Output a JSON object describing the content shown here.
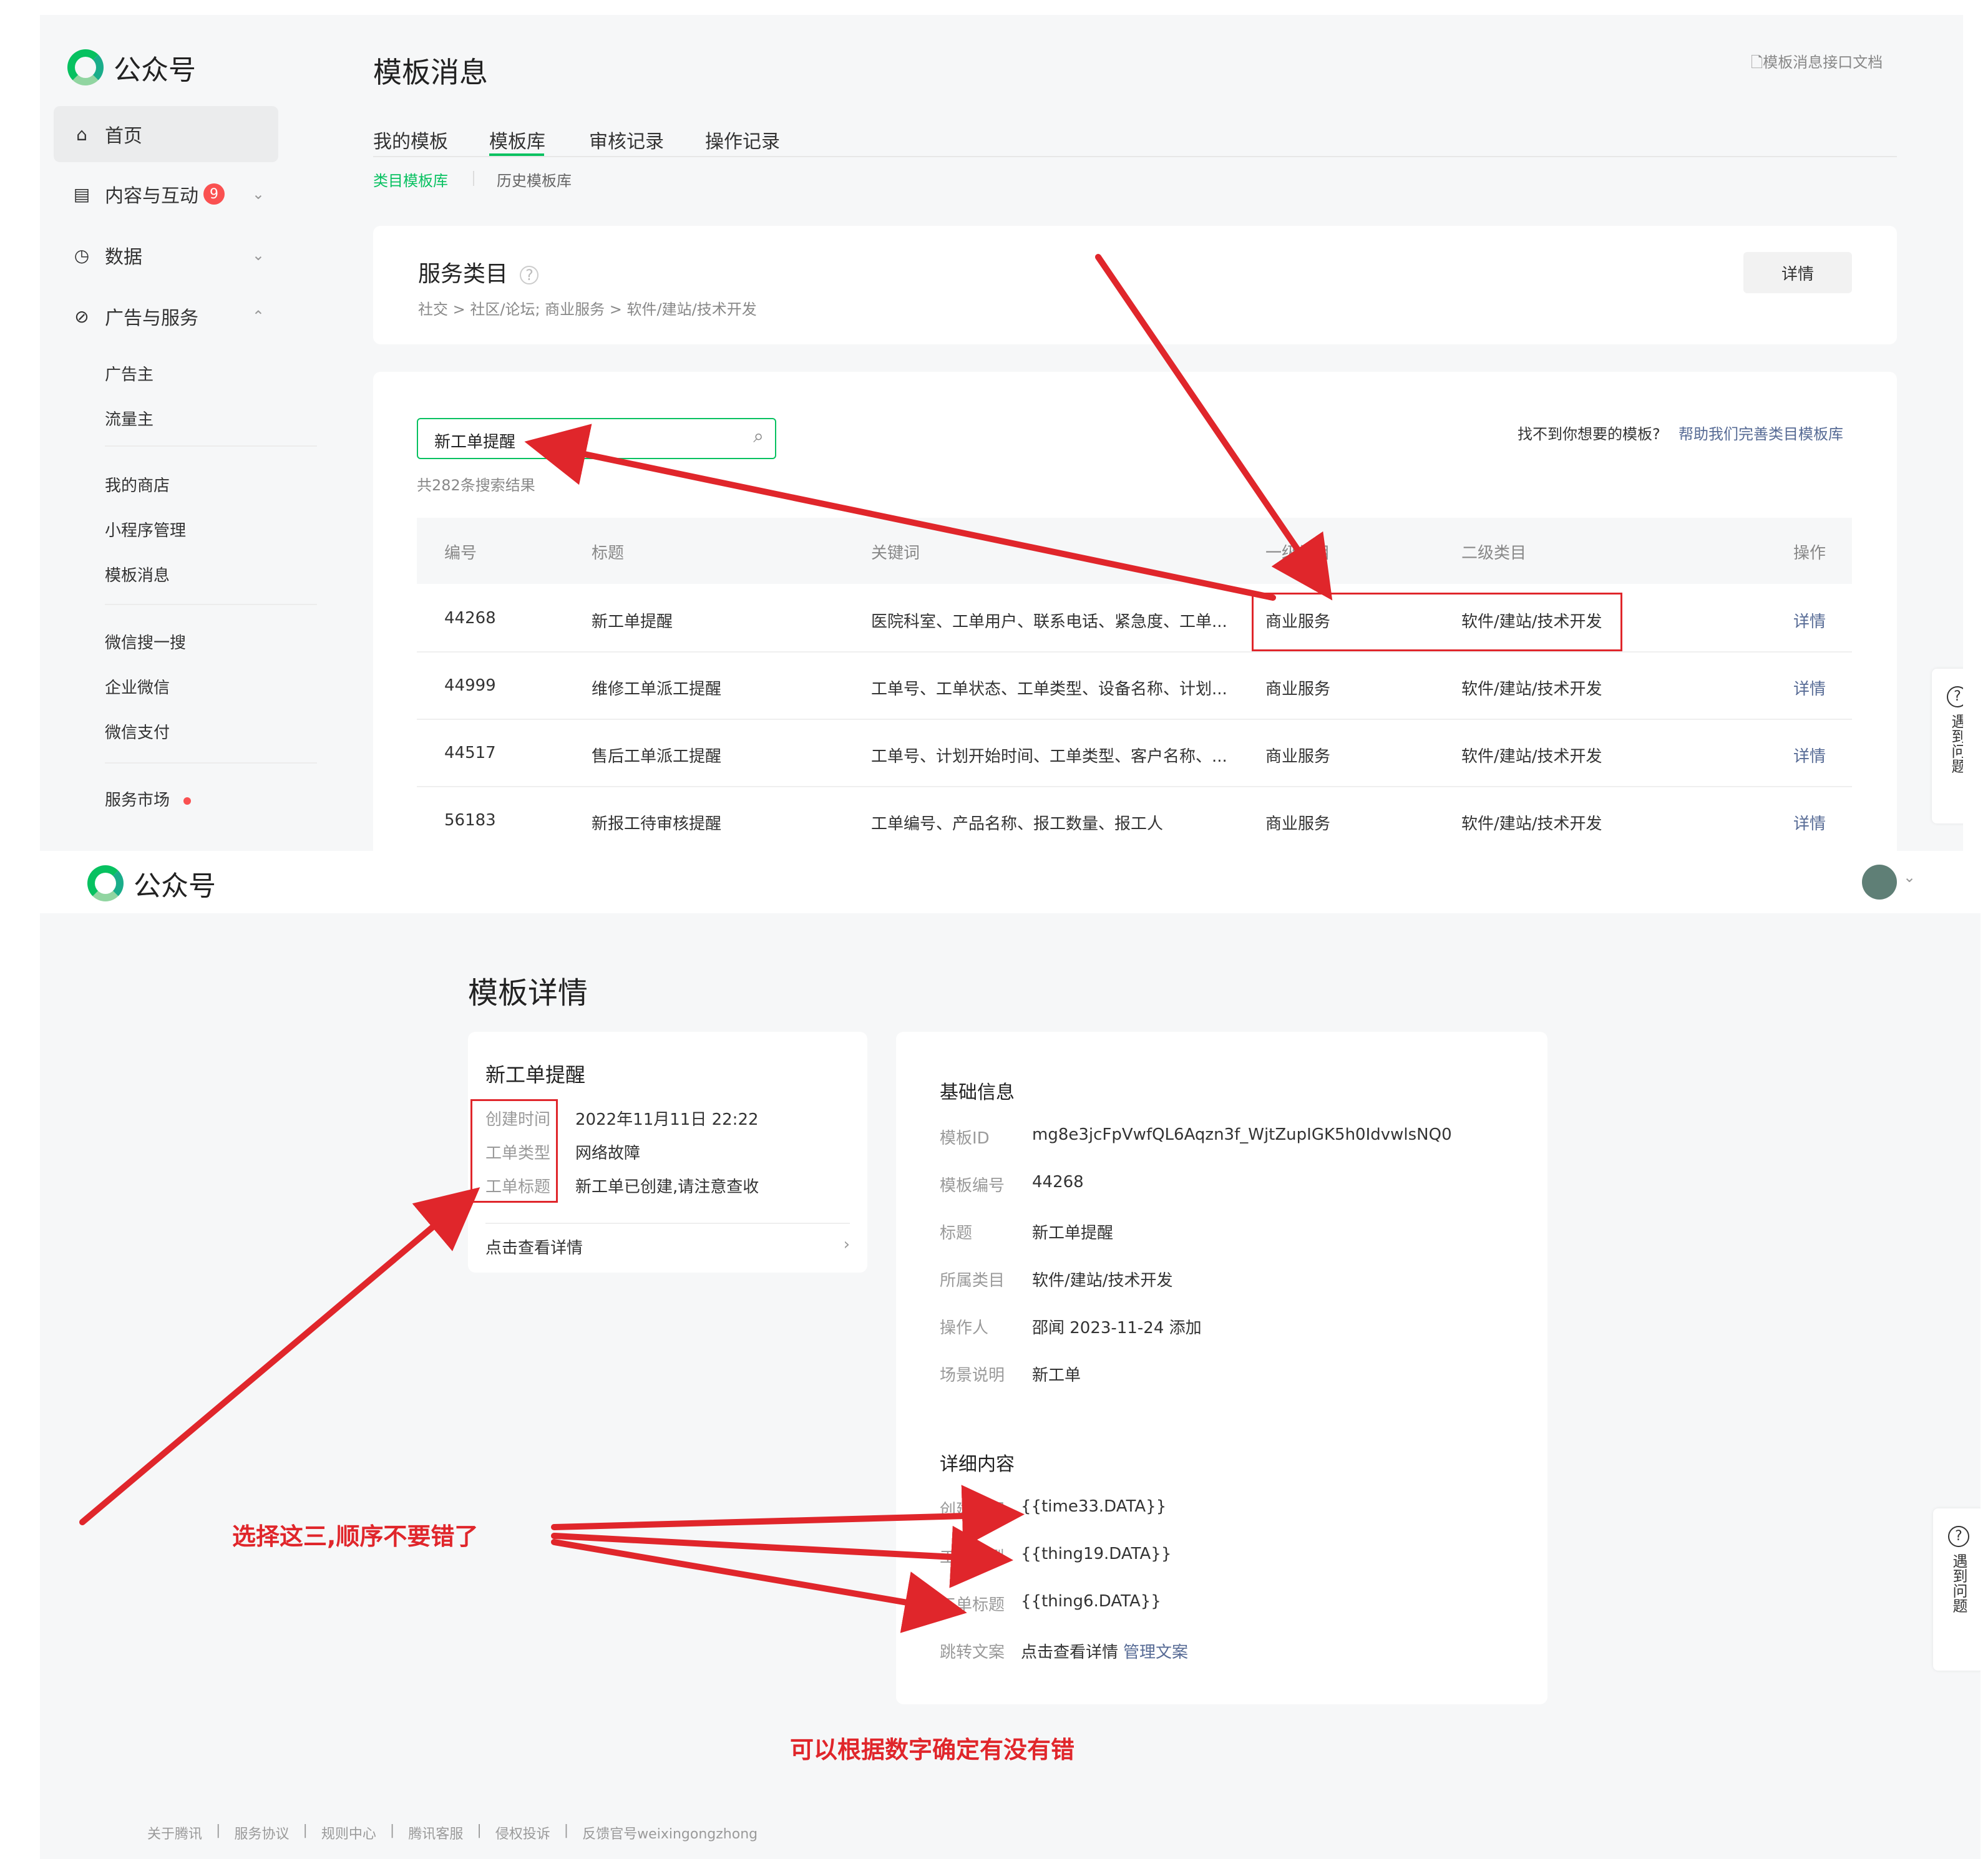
{
  "app": {
    "name": "公众号"
  },
  "sidebar": {
    "items": [
      {
        "label": "首页",
        "icon": "home-icon"
      },
      {
        "label": "内容与互动",
        "icon": "document-icon",
        "badge": "9"
      },
      {
        "label": "数据",
        "icon": "clock-icon"
      },
      {
        "label": "广告与服务",
        "icon": "compass-icon"
      }
    ],
    "sub_items_ads": [
      "广告主",
      "流量主"
    ],
    "sub_items_group2": [
      "我的商店",
      "小程序管理",
      "模板消息"
    ],
    "sub_items_group3": [
      "微信搜一搜",
      "企业微信",
      "微信支付"
    ],
    "service_market": "服务市场"
  },
  "top": {
    "page_title": "模板消息",
    "doc_link": "模板消息接口文档",
    "tabs": [
      "我的模板",
      "模板库",
      "审核记录",
      "操作记录"
    ],
    "subtabs": [
      "类目模板库",
      "历史模板库"
    ],
    "service_card": {
      "title": "服务类目",
      "path": "社交 > 社区/论坛; 商业服务 > 软件/建站/技术开发",
      "detail_button": "详情"
    },
    "search": {
      "value": "新工单提醒",
      "result_count": "共282条搜索结果",
      "help_question": "找不到你想要的模板?",
      "help_link": "帮助我们完善类目模板库"
    },
    "table": {
      "headers": [
        "编号",
        "标题",
        "关键词",
        "一级类目",
        "二级类目",
        "操作"
      ],
      "rows": [
        [
          "44268",
          "新工单提醒",
          "医院科室、工单用户、联系电话、紧急度、工单...",
          "商业服务",
          "软件/建站/技术开发",
          "详情"
        ],
        [
          "44999",
          "维修工单派工提醒",
          "工单号、工单状态、工单类型、设备名称、计划...",
          "商业服务",
          "软件/建站/技术开发",
          "详情"
        ],
        [
          "44517",
          "售后工单派工提醒",
          "工单号、计划开始时间、工单类型、客户名称、...",
          "商业服务",
          "软件/建站/技术开发",
          "详情"
        ],
        [
          "56183",
          "新报工待审核提醒",
          "工单编号、产品名称、报工数量、报工人",
          "商业服务",
          "软件/建站/技术开发",
          "详情"
        ]
      ]
    },
    "help_side": "遇到问题"
  },
  "bottom": {
    "page_title": "模板详情",
    "preview": {
      "title": "新工单提醒",
      "fields": [
        {
          "label": "创建时间",
          "value": "2022年11月11日 22:22"
        },
        {
          "label": "工单类型",
          "value": "网络故障"
        },
        {
          "label": "工单标题",
          "value": "新工单已创建,请注意查收"
        }
      ],
      "link": "点击查看详情"
    },
    "info": {
      "basic_title": "基础信息",
      "rows": [
        {
          "label": "模板ID",
          "value": "mg8e3jcFpVwfQL6Aqzn3f_WjtZupIGK5h0IdvwlsNQ0"
        },
        {
          "label": "模板编号",
          "value": "44268"
        },
        {
          "label": "标题",
          "value": "新工单提醒"
        },
        {
          "label": "所属类目",
          "value": "软件/建站/技术开发"
        },
        {
          "label": "操作人",
          "value": "邵闻 2023-11-24 添加"
        },
        {
          "label": "场景说明",
          "value": "新工单"
        }
      ],
      "detail_title": "详细内容",
      "detail_rows": [
        {
          "label": "创建时间",
          "value": "{{time33.DATA}}"
        },
        {
          "label": "工单类型",
          "value": "{{thing19.DATA}}"
        },
        {
          "label": "工单标题",
          "value": "{{thing6.DATA}}"
        },
        {
          "label": "跳转文案",
          "value": "点击查看详情",
          "link": "管理文案"
        }
      ]
    },
    "footer": [
      "关于腾讯",
      "服务协议",
      "规则中心",
      "腾讯客服",
      "侵权投诉",
      "反馈官号weixingongzhong"
    ],
    "help_side": "遇到问题"
  },
  "annotations": {
    "note1": "选择这三,顺序不要错了",
    "note2": "可以根据数字确定有没有错"
  },
  "colors": {
    "brand": "#07c160",
    "link": "#576b95",
    "annotation": "#e0262b",
    "badge": "#fa5151"
  }
}
